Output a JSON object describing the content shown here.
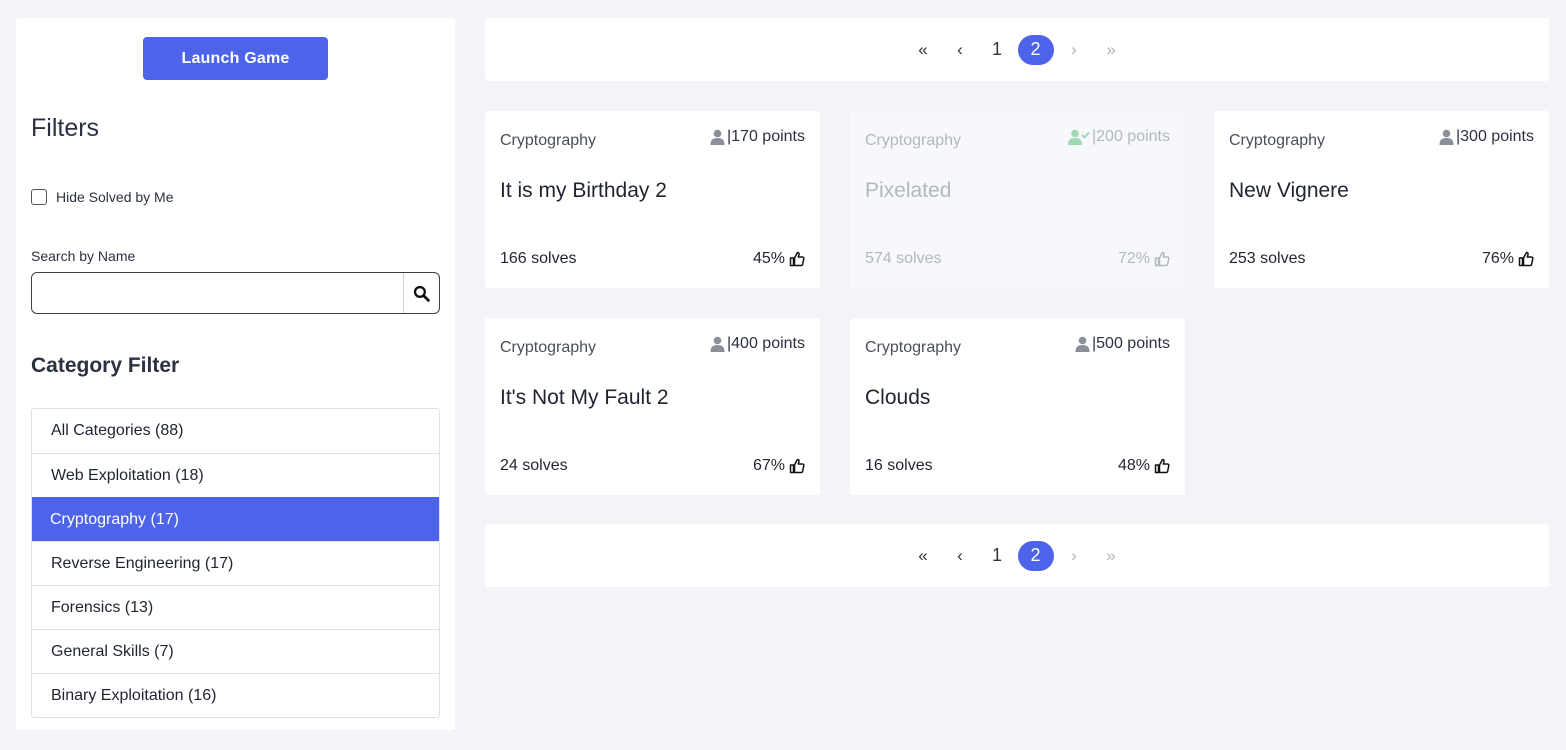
{
  "sidebar": {
    "launch_label": "Launch Game",
    "filters_title": "Filters",
    "hide_solved_label": "Hide Solved by Me",
    "search_label": "Search by Name",
    "search_value": "",
    "category_title": "Category Filter",
    "categories": [
      {
        "label": "All Categories  (88)",
        "active": false
      },
      {
        "label": "Web Exploitation (18)",
        "active": false
      },
      {
        "label": "Cryptography (17)",
        "active": true
      },
      {
        "label": "Reverse Engineering (17)",
        "active": false
      },
      {
        "label": "Forensics (13)",
        "active": false
      },
      {
        "label": "General Skills (7)",
        "active": false
      },
      {
        "label": "Binary Exploitation (16)",
        "active": false
      }
    ]
  },
  "pagination": {
    "first": "«",
    "prev": "‹",
    "pages": [
      "1",
      "2"
    ],
    "current": "2",
    "next": "›",
    "last": "»"
  },
  "challenges": [
    {
      "category": "Cryptography",
      "points": "|170 points",
      "name": "It is my Birthday 2",
      "solves": "166 solves",
      "rating": "45%",
      "solved": false
    },
    {
      "category": "Cryptography",
      "points": "|200 points",
      "name": "Pixelated",
      "solves": "574 solves",
      "rating": "72%",
      "solved": true
    },
    {
      "category": "Cryptography",
      "points": "|300 points",
      "name": "New Vignere",
      "solves": "253 solves",
      "rating": "76%",
      "solved": false
    },
    {
      "category": "Cryptography",
      "points": "|400 points",
      "name": "It's Not My Fault 2",
      "solves": "24 solves",
      "rating": "67%",
      "solved": false
    },
    {
      "category": "Cryptography",
      "points": "|500 points",
      "name": "Clouds",
      "solves": "16 solves",
      "rating": "48%",
      "solved": false
    }
  ],
  "icons": {
    "user": "user-icon",
    "user_check": "user-check-icon",
    "thumbs_up": "thumbs-up-icon",
    "search": "search-icon"
  },
  "colors": {
    "accent": "#4d63ea",
    "solved_icon": "#9fd8b4",
    "background": "#f3f4f8"
  }
}
